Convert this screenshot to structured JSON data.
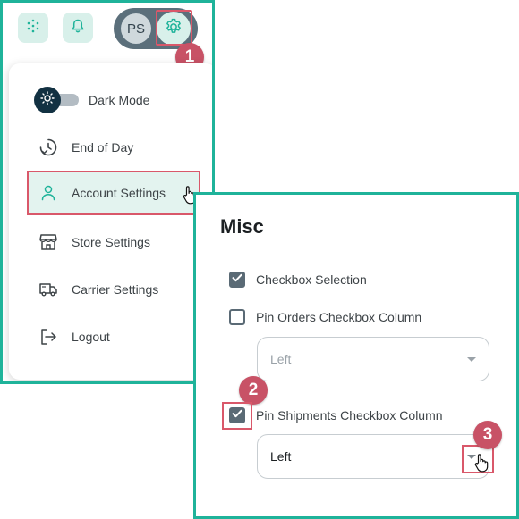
{
  "header": {
    "avatar_initials": "PS",
    "icons": [
      "apps-grid-icon",
      "bell-icon",
      "gear-icon"
    ]
  },
  "steps": [
    "1",
    "2",
    "3"
  ],
  "menu": {
    "items": [
      {
        "label": "Dark Mode",
        "icon": "sun-icon"
      },
      {
        "label": "End of Day",
        "icon": "clock-icon"
      },
      {
        "label": "Account Settings",
        "icon": "user-icon"
      },
      {
        "label": "Store Settings",
        "icon": "store-icon"
      },
      {
        "label": "Carrier Settings",
        "icon": "truck-icon"
      },
      {
        "label": "Logout",
        "icon": "logout-icon"
      }
    ]
  },
  "misc": {
    "title": "Misc",
    "checkbox_selection": {
      "label": "Checkbox Selection",
      "checked": true
    },
    "pin_orders": {
      "label": "Pin Orders Checkbox Column",
      "checked": false,
      "select_value": "Left"
    },
    "pin_shipments": {
      "label": "Pin Shipments Checkbox Column",
      "checked": true,
      "select_value": "Left"
    }
  },
  "colors": {
    "accent": "#1fb39a",
    "highlight": "#d9586a",
    "badge": "#c85266",
    "pill": "#5b6f7b"
  }
}
